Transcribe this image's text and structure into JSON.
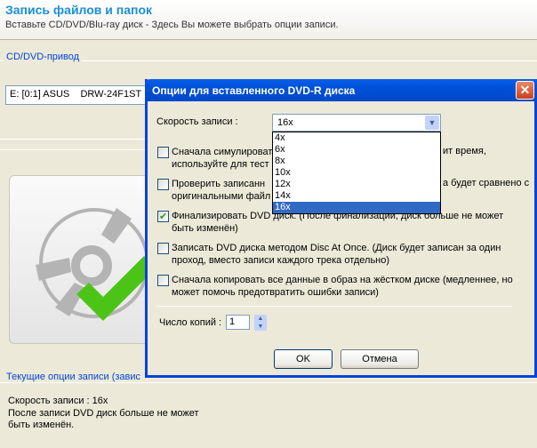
{
  "header": {
    "title": "Запись файлов и папок",
    "subtitle": "Вставьте CD/DVD/Blu-ray диск - Здесь Вы можете выбрать опции записи."
  },
  "drive_group": {
    "label": "CD/DVD-привод",
    "drive": "E: [0:1] ASUS    DRW-24F1ST"
  },
  "current": {
    "label": "Текущие опции записи (завис",
    "lines": [
      "Скорость записи : 16x",
      "После записи DVD диск больше не может",
      "быть изменён."
    ]
  },
  "dialog": {
    "title": "Опции для вставленного DVD-R диска",
    "speed_label": "Скорость записи :",
    "speed_value": "16x",
    "speed_options": [
      "4x",
      "6x",
      "8x",
      "10x",
      "12x",
      "14x",
      "16x"
    ],
    "options": [
      {
        "l1": "Сначала симулироват",
        "l2": "используйте для тест",
        "r1": "ит время,",
        "checked": false
      },
      {
        "l1": "Проверить записанн",
        "l2": "оригинальными файл",
        "r1": "а будет сравнено с",
        "checked": false
      },
      {
        "l1": "Финализировать DVD диск. (После финализации, диск больше не может",
        "l2": "быть изменён)",
        "checked": true
      },
      {
        "l1": "Записать DVD диска методом Disc At Once. (Диск будет записан за один",
        "l2": "проход, вместо записи каждого трека отдельно)",
        "checked": false
      },
      {
        "l1": "Сначала копировать все данные в образ на жёстком диске (медленнее, но",
        "l2": "может помочь предотвратить ошибки записи)",
        "checked": false
      }
    ],
    "copies_label": "Число копий :",
    "copies_value": "1",
    "ok": "OK",
    "cancel": "Отмена",
    "close": "✕"
  },
  "colors": {
    "title_bar": "#0054e3",
    "selection": "#316ac5",
    "check": "#4cc417"
  }
}
